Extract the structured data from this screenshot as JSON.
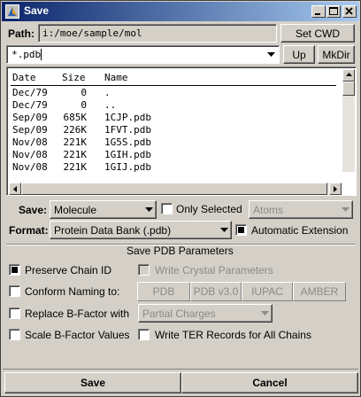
{
  "window": {
    "title": "Save"
  },
  "path": {
    "label": "Path:",
    "value": "i:/moe/sample/mol",
    "set_cwd": "Set CWD"
  },
  "filter": {
    "value": "*.pdb",
    "up": "Up",
    "mkdir": "MkDir"
  },
  "file_list": {
    "headers": {
      "date": "Date",
      "size": "Size",
      "name": "Name"
    },
    "rows": [
      {
        "date": "Dec/79",
        "size": "0",
        "name": "."
      },
      {
        "date": "Dec/79",
        "size": "0",
        "name": ".."
      },
      {
        "date": "Sep/09",
        "size": "685K",
        "name": "1CJP.pdb"
      },
      {
        "date": "Sep/09",
        "size": "226K",
        "name": "1FVT.pdb"
      },
      {
        "date": "Nov/08",
        "size": "221K",
        "name": "1G5S.pdb"
      },
      {
        "date": "Nov/08",
        "size": "221K",
        "name": "1GIH.pdb"
      },
      {
        "date": "Nov/08",
        "size": "221K",
        "name": "1GIJ.pdb"
      }
    ]
  },
  "save_opts": {
    "save_label": "Save:",
    "save_value": "Molecule",
    "only_selected": "Only Selected",
    "only_selected_checked": false,
    "atoms_value": "Atoms",
    "format_label": "Format:",
    "format_value": "Protein Data Bank (.pdb)",
    "auto_ext": "Automatic Extension",
    "auto_ext_checked": true
  },
  "pdb_params": {
    "section_title": "Save PDB Parameters",
    "preserve_chain": "Preserve Chain ID",
    "preserve_chain_checked": true,
    "write_crystal": "Write Crystal Parameters",
    "conform_naming": "Conform Naming to:",
    "naming_options": [
      "PDB",
      "PDB v3.0",
      "IUPAC",
      "AMBER"
    ],
    "replace_bfactor": "Replace B-Factor with",
    "bfactor_source": "Partial Charges",
    "scale_bfactor": "Scale B-Factor Values",
    "write_ter": "Write TER Records for All Chains"
  },
  "footer": {
    "save": "Save",
    "cancel": "Cancel"
  }
}
